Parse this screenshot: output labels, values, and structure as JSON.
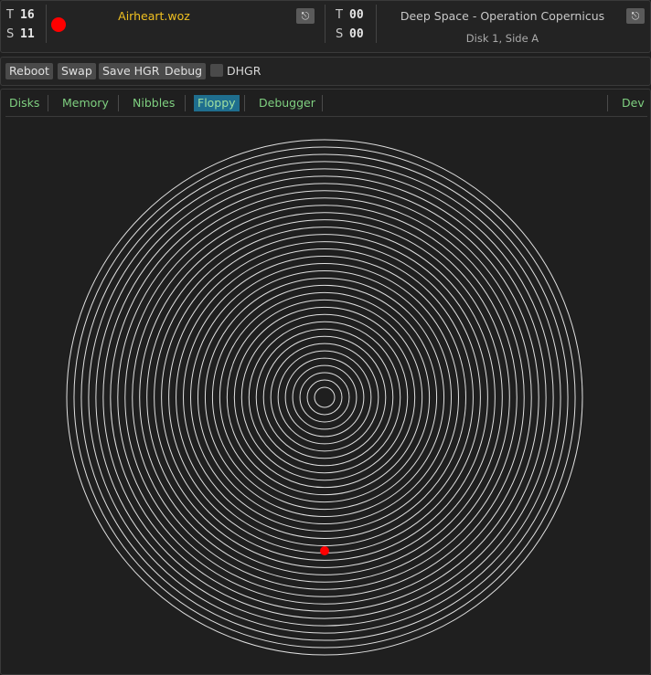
{
  "drive1": {
    "track_label": "T",
    "track": "16",
    "sector_label": "S",
    "sector": "11",
    "led_color": "#ff0000",
    "disk_name": "Airheart.woz",
    "eject_icon": "eject-icon"
  },
  "drive2": {
    "track_label": "T",
    "track": "00",
    "sector_label": "S",
    "sector": "00",
    "disk_name": "Deep Space - Operation Copernicus",
    "disk_side": "Disk 1, Side A",
    "eject_icon": "eject-icon"
  },
  "controls": {
    "reboot": "Reboot",
    "swap": "Swap",
    "save_hgr": "Save HGR",
    "debug": "Debug",
    "dhgr_label": "DHGR",
    "dhgr_checked": false
  },
  "tabs": [
    {
      "label": "Disks",
      "active": false
    },
    {
      "label": "Memory",
      "active": false
    },
    {
      "label": "Nibbles",
      "active": false
    },
    {
      "label": "Floppy",
      "active": true
    },
    {
      "label": "Debugger",
      "active": false
    },
    {
      "label": "Dev",
      "active": false
    }
  ],
  "floppy": {
    "track_rings": 35,
    "ring_color": "#e0e0e0",
    "head_color": "#ff0000",
    "head_track": 16
  }
}
